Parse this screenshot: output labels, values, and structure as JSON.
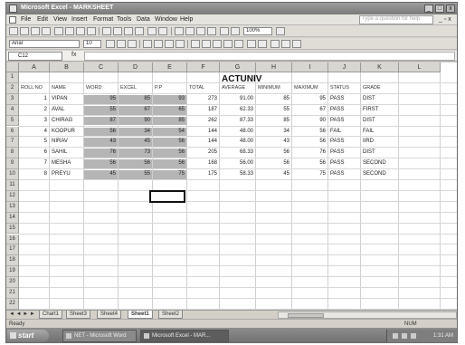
{
  "window": {
    "title": "Microsoft Excel - MARKSHEET",
    "minimize": "_",
    "maximize": "□",
    "close": "x"
  },
  "menu": {
    "items": [
      "File",
      "Edit",
      "View",
      "Insert",
      "Format",
      "Tools",
      "Data",
      "Window",
      "Help"
    ],
    "help_placeholder": "Type a question for help",
    "doc_controls": "_ ▫ x"
  },
  "toolbar": {
    "zoom": "100%",
    "font": "Arial",
    "font_size": "10"
  },
  "formula_bar": {
    "name_box": "C12",
    "fx": "fx",
    "content": ""
  },
  "sheet": {
    "columns": [
      "A",
      "B",
      "C",
      "D",
      "E",
      "F",
      "G",
      "H",
      "I",
      "J",
      "K",
      "L"
    ],
    "rows": [
      "1",
      "2",
      "3",
      "4",
      "5",
      "6",
      "7",
      "8",
      "9",
      "10",
      "11",
      "12",
      "13",
      "14",
      "15",
      "16",
      "17",
      "18",
      "19",
      "20",
      "21",
      "22"
    ],
    "title": "ACTUNIV",
    "headers": [
      "ROLL NO",
      "NAME",
      "WORD",
      "EXCEL",
      "P.P",
      "TOTAL",
      "AVERAGE",
      "MINIMUM",
      "MAXIMUM",
      "STATUS",
      "GRADE"
    ],
    "records": [
      {
        "roll": "1",
        "name": "VIPAN",
        "word": "95",
        "excel": "85",
        "pp": "93",
        "total": "273",
        "average": "91.00",
        "minimum": "85",
        "maximum": "95",
        "status": "PASS",
        "grade": "DIST"
      },
      {
        "roll": "2",
        "name": "AVAL",
        "word": "55",
        "excel": "67",
        "pp": "65",
        "total": "187",
        "average": "62.33",
        "minimum": "55",
        "maximum": "67",
        "status": "PASS",
        "grade": "FIRST"
      },
      {
        "roll": "3",
        "name": "CHIRAG",
        "word": "87",
        "excel": "90",
        "pp": "85",
        "total": "262",
        "average": "87.33",
        "minimum": "85",
        "maximum": "90",
        "status": "PASS",
        "grade": "DIST"
      },
      {
        "roll": "4",
        "name": "KOOPUR",
        "word": "56",
        "excel": "34",
        "pp": "54",
        "total": "144",
        "average": "48.00",
        "minimum": "34",
        "maximum": "56",
        "status": "FAIL",
        "grade": "FAIL"
      },
      {
        "roll": "5",
        "name": "NIRAV",
        "word": "43",
        "excel": "45",
        "pp": "56",
        "total": "144",
        "average": "48.00",
        "minimum": "43",
        "maximum": "56",
        "status": "PASS",
        "grade": "IIRD"
      },
      {
        "roll": "6",
        "name": "SAHIL",
        "word": "76",
        "excel": "73",
        "pp": "56",
        "total": "205",
        "average": "68.33",
        "minimum": "56",
        "maximum": "76",
        "status": "PASS",
        "grade": "DIST"
      },
      {
        "roll": "7",
        "name": "MESHA",
        "word": "56",
        "excel": "56",
        "pp": "56",
        "total": "168",
        "average": "56.00",
        "minimum": "56",
        "maximum": "56",
        "status": "PASS",
        "grade": "SECOND"
      },
      {
        "roll": "8",
        "name": "PREYU",
        "word": "45",
        "excel": "55",
        "pp": "75",
        "total": "175",
        "average": "58.33",
        "minimum": "45",
        "maximum": "75",
        "status": "PASS",
        "grade": "SECOND"
      }
    ]
  },
  "sheet_tabs": {
    "nav": "◄ ◄ ► ►",
    "tabs": [
      "Chart1",
      "Sheet3",
      "Sheet4",
      "Sheet1",
      "Sheet2"
    ],
    "active": "Sheet1"
  },
  "status": {
    "left": "Ready",
    "right": "NUM"
  },
  "taskbar": {
    "start": "start",
    "tasks": [
      "NET - Microsoft Word",
      "Microsoft Excel - MAR..."
    ],
    "clock": "1:31 AM"
  },
  "colors": {
    "shade": "#b5b5b5",
    "titlebar": "#8a8a8a",
    "taskbar": "#7a7a7a"
  }
}
